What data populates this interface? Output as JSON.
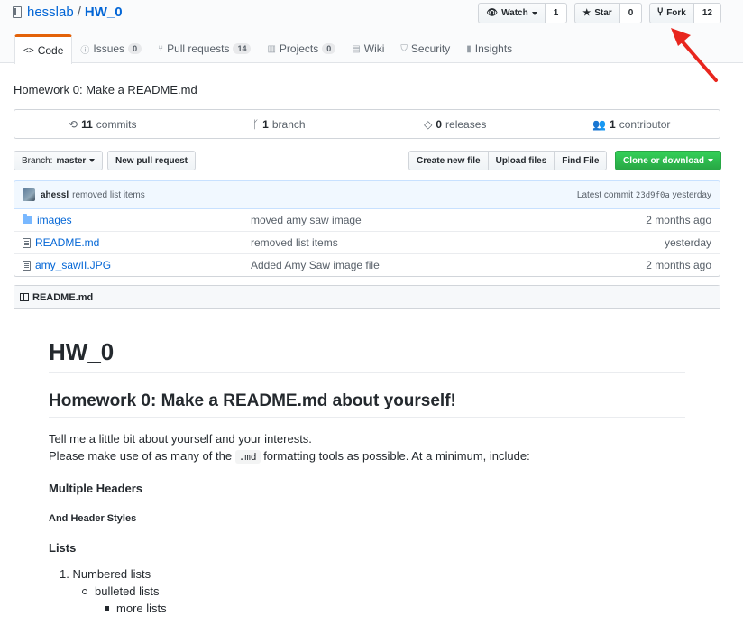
{
  "repo": {
    "owner": "hesslab",
    "separator": "/",
    "name": "HW_0"
  },
  "actions": {
    "watch": {
      "label": "Watch",
      "count": "1"
    },
    "star": {
      "label": "Star",
      "count": "0"
    },
    "fork": {
      "label": "Fork",
      "count": "12"
    }
  },
  "tabs": [
    {
      "label": "Code",
      "icon": "code-icon"
    },
    {
      "label": "Issues",
      "count": "0",
      "icon": "issue-icon"
    },
    {
      "label": "Pull requests",
      "count": "14",
      "icon": "pull-request-icon"
    },
    {
      "label": "Projects",
      "count": "0",
      "icon": "project-icon"
    },
    {
      "label": "Wiki",
      "icon": "book-icon"
    },
    {
      "label": "Security",
      "icon": "shield-icon"
    },
    {
      "label": "Insights",
      "icon": "graph-icon"
    }
  ],
  "description": "Homework 0: Make a README.md",
  "numbers": {
    "commits_count": "11",
    "commits_label": "commits",
    "branch_count": "1",
    "branch_label": "branch",
    "releases_count": "0",
    "releases_label": "releases",
    "contributor_count": "1",
    "contributor_label": "contributor"
  },
  "branch": {
    "prefix": "Branch:",
    "name": "master"
  },
  "buttons": {
    "new_pr": "New pull request",
    "create_file": "Create new file",
    "upload_files": "Upload files",
    "find_file": "Find File",
    "clone": "Clone or download"
  },
  "latest_commit": {
    "author": "ahessl",
    "message": "removed list items",
    "prefix": "Latest commit",
    "sha": "23d9f0a",
    "age": "yesterday"
  },
  "files": [
    {
      "name": "images",
      "type": "folder",
      "message": "moved amy saw image",
      "age": "2 months ago"
    },
    {
      "name": "README.md",
      "type": "file",
      "message": "removed list items",
      "age": "yesterday"
    },
    {
      "name": "amy_sawII.JPG",
      "type": "file",
      "message": "Added Amy Saw image file",
      "age": "2 months ago"
    }
  ],
  "readme": {
    "header": "README.md",
    "h1": "HW_0",
    "h2": "Homework 0: Make a README.md about yourself!",
    "p1_line1": "Tell me a little bit about yourself and your interests.",
    "p1_line2_pre": "Please make use of as many of the",
    "p1_code": ".md",
    "p1_line2_post": "formatting tools as possible. At a minimum, include:",
    "h3": "Multiple Headers",
    "h5": "And Header Styles",
    "h4": "Lists",
    "li1": "1. Numbered lists",
    "li2": "bulleted lists",
    "li3": "more lists"
  },
  "colors": {
    "accent": "#0366d6",
    "tab_highlight": "#e36209",
    "clone_green": "#28a745",
    "annotation_arrow": "#e8261e"
  }
}
